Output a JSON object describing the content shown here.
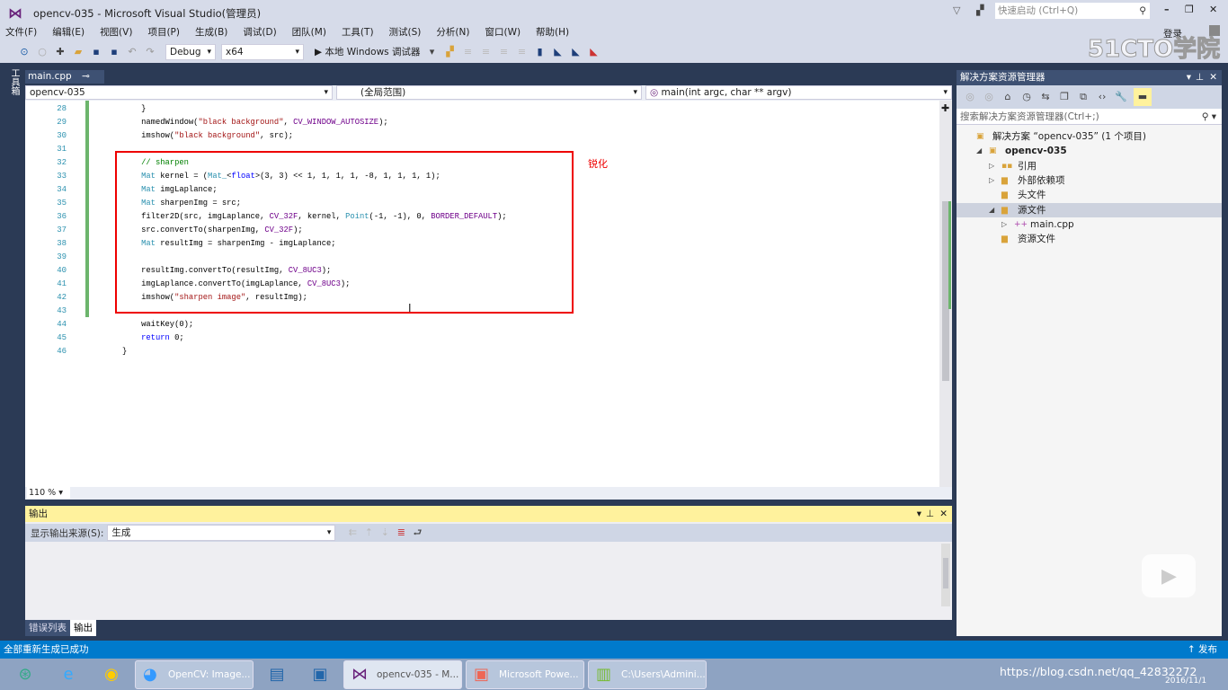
{
  "window": {
    "title": "opencv-035 - Microsoft Visual Studio(管理员)",
    "quick_launch_placeholder": "快速启动 (Ctrl+Q)",
    "login": "登录",
    "watermark": "51CTO学院"
  },
  "menu": [
    "文件(F)",
    "编辑(E)",
    "视图(V)",
    "项目(P)",
    "生成(B)",
    "调试(D)",
    "团队(M)",
    "工具(T)",
    "测试(S)",
    "分析(N)",
    "窗口(W)",
    "帮助(H)"
  ],
  "toolbar": {
    "config": "Debug",
    "platform": "x64",
    "run_label": "▶ 本地 Windows 调试器"
  },
  "left_tool": "工具箱",
  "editor": {
    "tab": "main.cpp",
    "nav": {
      "project": "opencv-035",
      "scope": "(全局范围)",
      "member": "main(int argc, char ** argv)"
    },
    "annotation": "锐化",
    "zoom": "110 %",
    "lines": [
      {
        "num": "28",
        "segs": [
          {
            "t": "    }",
            "c": "tx"
          }
        ]
      },
      {
        "num": "29",
        "segs": [
          {
            "t": "    namedWindow(",
            "c": "tx"
          },
          {
            "t": "\"black background\"",
            "c": "st"
          },
          {
            "t": ", ",
            "c": "tx"
          },
          {
            "t": "CV_WINDOW_AUTOSIZE",
            "c": "mc"
          },
          {
            "t": ");",
            "c": "tx"
          }
        ]
      },
      {
        "num": "30",
        "segs": [
          {
            "t": "    imshow(",
            "c": "tx"
          },
          {
            "t": "\"black background\"",
            "c": "st"
          },
          {
            "t": ", src);",
            "c": "tx"
          }
        ]
      },
      {
        "num": "31",
        "segs": []
      },
      {
        "num": "32",
        "segs": [
          {
            "t": "    // sharpen",
            "c": "cm"
          }
        ]
      },
      {
        "num": "33",
        "segs": [
          {
            "t": "    ",
            "c": "tx"
          },
          {
            "t": "Mat",
            "c": "ty"
          },
          {
            "t": " kernel = (",
            "c": "tx"
          },
          {
            "t": "Mat_",
            "c": "ty"
          },
          {
            "t": "<",
            "c": "tx"
          },
          {
            "t": "float",
            "c": "kw"
          },
          {
            "t": ">(3, 3) << 1, 1, 1, 1, -8, 1, 1, 1, 1);",
            "c": "tx"
          }
        ]
      },
      {
        "num": "34",
        "segs": [
          {
            "t": "    ",
            "c": "tx"
          },
          {
            "t": "Mat",
            "c": "ty"
          },
          {
            "t": " imgLaplance;",
            "c": "tx"
          }
        ]
      },
      {
        "num": "35",
        "segs": [
          {
            "t": "    ",
            "c": "tx"
          },
          {
            "t": "Mat",
            "c": "ty"
          },
          {
            "t": " sharpenImg = src;",
            "c": "tx"
          }
        ]
      },
      {
        "num": "36",
        "segs": [
          {
            "t": "    filter2D(src, imgLaplance, ",
            "c": "tx"
          },
          {
            "t": "CV_32F",
            "c": "mc"
          },
          {
            "t": ", kernel, ",
            "c": "tx"
          },
          {
            "t": "Point",
            "c": "ty"
          },
          {
            "t": "(-1, -1), 0, ",
            "c": "tx"
          },
          {
            "t": "BORDER_DEFAULT",
            "c": "mc"
          },
          {
            "t": ");",
            "c": "tx"
          }
        ]
      },
      {
        "num": "37",
        "segs": [
          {
            "t": "    src.convertTo(sharpenImg, ",
            "c": "tx"
          },
          {
            "t": "CV_32F",
            "c": "mc"
          },
          {
            "t": ");",
            "c": "tx"
          }
        ]
      },
      {
        "num": "38",
        "segs": [
          {
            "t": "    ",
            "c": "tx"
          },
          {
            "t": "Mat",
            "c": "ty"
          },
          {
            "t": " resultImg = sharpenImg - imgLaplance;",
            "c": "tx"
          }
        ]
      },
      {
        "num": "39",
        "segs": []
      },
      {
        "num": "40",
        "segs": [
          {
            "t": "    resultImg.convertTo(resultImg, ",
            "c": "tx"
          },
          {
            "t": "CV_8UC3",
            "c": "mc"
          },
          {
            "t": ");",
            "c": "tx"
          }
        ]
      },
      {
        "num": "41",
        "segs": [
          {
            "t": "    imgLaplance.convertTo(imgLaplance, ",
            "c": "tx"
          },
          {
            "t": "CV_8UC3",
            "c": "mc"
          },
          {
            "t": ");",
            "c": "tx"
          }
        ]
      },
      {
        "num": "42",
        "segs": [
          {
            "t": "    imshow(",
            "c": "tx"
          },
          {
            "t": "\"sharpen image\"",
            "c": "st"
          },
          {
            "t": ", resultImg);",
            "c": "tx"
          }
        ]
      },
      {
        "num": "43",
        "segs": []
      },
      {
        "num": "44",
        "segs": [
          {
            "t": "    waitKey(0);",
            "c": "tx"
          }
        ]
      },
      {
        "num": "45",
        "segs": [
          {
            "t": "    ",
            "c": "tx"
          },
          {
            "t": "return",
            "c": "kw"
          },
          {
            "t": " 0;",
            "c": "tx"
          }
        ]
      },
      {
        "num": "46",
        "segs": [
          {
            "t": "}",
            "c": "tx"
          }
        ]
      }
    ]
  },
  "output": {
    "title": "输出",
    "source_label": "显示输出来源(S):",
    "source_value": "生成",
    "tabs": [
      "错误列表",
      "输出"
    ]
  },
  "solution": {
    "title": "解决方案资源管理器",
    "search_placeholder": "搜索解决方案资源管理器(Ctrl+;)",
    "tree": [
      {
        "label": "解决方案 “opencv-035” (1 个项目)",
        "indent": 0,
        "arrow": "",
        "icon": "▣"
      },
      {
        "label": "opencv-035",
        "indent": 1,
        "arrow": "◢",
        "icon": "▣",
        "bold": true
      },
      {
        "label": "引用",
        "indent": 2,
        "arrow": "▷",
        "icon": "▪▪"
      },
      {
        "label": "外部依赖项",
        "indent": 2,
        "arrow": "▷",
        "icon": "▆"
      },
      {
        "label": "头文件",
        "indent": 2,
        "arrow": "",
        "icon": "▆"
      },
      {
        "label": "源文件",
        "indent": 2,
        "arrow": "◢",
        "icon": "▆",
        "selected": true
      },
      {
        "label": "main.cpp",
        "indent": 3,
        "arrow": "▷",
        "icon": "++"
      },
      {
        "label": "资源文件",
        "indent": 2,
        "arrow": "",
        "icon": "▆"
      }
    ]
  },
  "status": {
    "message": "全部重新生成已成功",
    "publish": "↑ 发布"
  },
  "taskbar": {
    "items": [
      "OpenCV: Image...",
      "opencv-035 - M...",
      "Microsoft Powe...",
      "C:\\Users\\Admini..."
    ],
    "overlay": "https://blog.csdn.net/qq_42832272",
    "date": "2016/11/1"
  }
}
